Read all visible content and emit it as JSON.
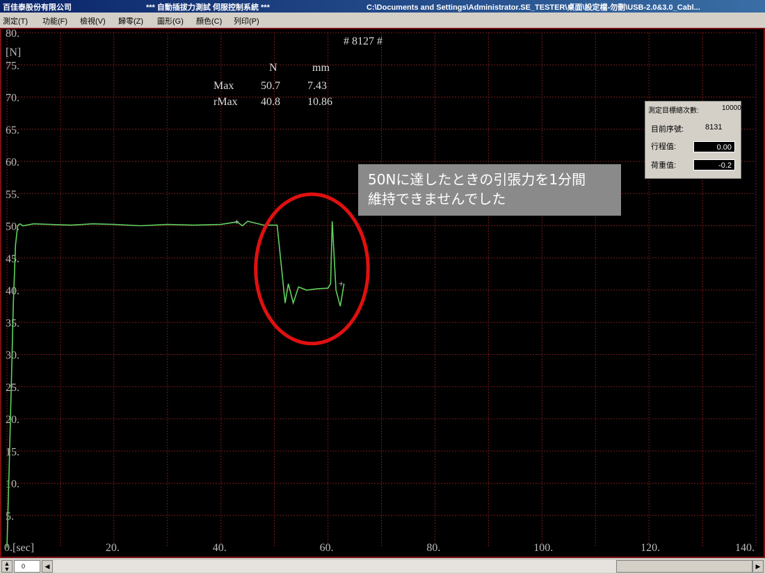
{
  "window": {
    "company": "百佳泰股份有限公司",
    "app_title": "*** 自動插拔力測試 伺服控制系統 ***",
    "path": "C:\\Documents and Settings\\Administrator.SE_TESTER\\桌面\\設定檔-勿刪\\USB-2.0&3.0_Cabl..."
  },
  "menu": [
    "測定(T)",
    "功能(F)",
    "檢視(V)",
    "歸零(Z)",
    "圖形(G)",
    "顏色(C)",
    "列印(P)"
  ],
  "test_id": "# 8127 #",
  "stats": {
    "col_n": "N",
    "col_mm": "mm",
    "max_label": "Max",
    "max_n": "50.7",
    "max_mm": "7.43",
    "rmax_label": "rMax",
    "rmax_n": "40.8",
    "rmax_mm": "10.86"
  },
  "info_panel": {
    "total_label": "測定目標總次數:",
    "total_value": "10000",
    "seq_label": "目前序號:",
    "seq_value": "8131",
    "stroke_label": "行程值:",
    "stroke_value": "0.00",
    "load_label": "荷重值:",
    "load_value": "-0.2"
  },
  "callout": {
    "line1": "50Nに達したときの引張力を1分間",
    "line2": "維持できませんでした"
  },
  "status": {
    "field_value": "0"
  },
  "colors": {
    "trace": "#5fd25f",
    "grid": "#7a1a1a",
    "highlight": "#e01010",
    "background": "#000000"
  },
  "chart_data": {
    "type": "line",
    "y_unit_label": "[N]",
    "x_unit_label": "[sec]",
    "x_ticks": [
      "0.",
      "20.",
      "40.",
      "60.",
      "80.",
      "100.",
      "120.",
      "140."
    ],
    "y_ticks": [
      "5.",
      "10.",
      "15.",
      "20.",
      "25.",
      "30.",
      "35.",
      "40.",
      "45.",
      "50.",
      "55.",
      "60.",
      "65.",
      "70.",
      "75.",
      "80."
    ],
    "xlim": [
      0,
      140
    ],
    "ylim": [
      0,
      80
    ],
    "grid": true,
    "series": [
      {
        "x": [
          0,
          0.4,
          0.8,
          1.2,
          1.6,
          2.0,
          2.4,
          3.0,
          5,
          8,
          12,
          16,
          20,
          25,
          30,
          35,
          40,
          43,
          44,
          45,
          48,
          50.5,
          52,
          52.6,
          53.5,
          54.5,
          56,
          58,
          60,
          60.5,
          60.8,
          61.5,
          62.3,
          63
        ],
        "y": [
          0,
          12,
          25,
          38,
          47,
          50,
          50.3,
          50,
          50.3,
          50.2,
          50.1,
          50.3,
          50.2,
          50,
          50.2,
          50.1,
          50.2,
          50.6,
          50,
          50.7,
          50.1,
          50.1,
          38,
          41,
          38,
          40.5,
          40,
          40.2,
          40.3,
          41,
          50.7,
          40,
          37.5,
          41
        ]
      }
    ],
    "markers": [
      {
        "x": 43,
        "y": 50.6,
        "symbol": "+"
      },
      {
        "x": 62.5,
        "y": 41,
        "symbol": "+"
      }
    ],
    "highlight_ellipse": {
      "cx": 57,
      "cy": 43.3,
      "rx": 10.5,
      "ry": 11.6
    }
  }
}
